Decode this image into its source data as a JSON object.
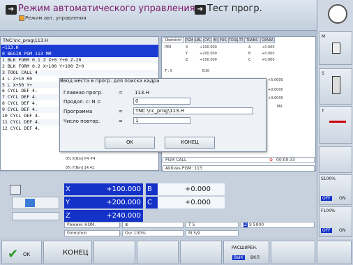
{
  "header": {
    "mode1_title": "Режим автоматического управления",
    "mode1_sub": "Режим авт. управления",
    "mode2_title": "Тест прогр."
  },
  "program": {
    "path": "TNC:\\nc_prog\\113.H",
    "current": "→113.H",
    "lines": [
      "0  BEGIN PGM 113 MM",
      "1  BLK FORM 0.1 Z X+0 Y+0 Z-20",
      "2  BLK FORM 0.2  X+100  Y+100  Z+0",
      "3  TOOL CALL 4",
      "4  L  Z+10 R0",
      "5  L  X+50  Y+",
      "6  CYCL DEF 4.",
      "7  CYCL DEF 4.",
      "8  CYCL DEF 4.",
      "9  CYCL DEF 4.",
      "10 CYCL DEF 4.",
      "11 CYCL DEF 4.",
      "12 CYCL DEF 4."
    ]
  },
  "status": {
    "tabs": [
      "Übersicht",
      "PGM",
      "LBL",
      "CYC",
      "M",
      "POS",
      "TOOL",
      "TT",
      "TRANS",
      "QPARA"
    ],
    "rows": [
      {
        "a": "PER",
        "b": "X",
        "c": "+100.000",
        "d": "A",
        "e": "+0.000"
      },
      {
        "a": "",
        "b": "Y",
        "c": "+200.000",
        "d": "B",
        "e": "+0.000"
      },
      {
        "a": "",
        "b": "Z",
        "c": "+100.000",
        "d": "C",
        "e": "+0.000"
      }
    ],
    "t_label": "T :  5",
    "t_name": "D10",
    "vals": [
      "+5.0000",
      "+0.0000",
      "+0.0000"
    ],
    "m": "M9",
    "pgm_call": "PGM CALL",
    "time": "00:00:33",
    "aktives": "Aktives PGM: 113",
    "bar1": "0% X[Nm] P4 -T4",
    "bar2": "0% Y[Nm] 14:41"
  },
  "dialog": {
    "title": "Ввод места в прогр. для поиска кадра",
    "main_label": "Главная прогр.",
    "main_eq": "=",
    "main_val": "113.H",
    "cont_label": "Продол. с:  N =",
    "cont_val": "0",
    "prog_label": "Программа",
    "prog_eq": "=",
    "prog_val": "TNC:\\nc_prog\\113.H",
    "rep_label": "Число повтор.",
    "rep_eq": "=",
    "rep_val": "1",
    "ok": "OK",
    "end": "КОНЕЦ"
  },
  "positions": {
    "axes": [
      {
        "l": "X",
        "v": "+100.000"
      },
      {
        "l": "Y",
        "v": "+200.000"
      },
      {
        "l": "Z",
        "v": "+240.000"
      }
    ],
    "axes2": [
      {
        "l": "B",
        "v": "+0.000"
      },
      {
        "l": "C",
        "v": "+0.000"
      }
    ],
    "mode": "Режим: НОМ.",
    "feed": "0mm/min",
    "ovr": "Ovr 100%",
    "t": "T 5",
    "s": "S 5000",
    "m": "M 5/9",
    "zlabel": "Z"
  },
  "right": {
    "m": "M",
    "s": "S",
    "t": "T",
    "s100": "S100%",
    "f100": "F100%",
    "off": "OFF",
    "on": "ON"
  },
  "softkeys": {
    "ok": "OK",
    "end": "КОНЕЦ",
    "ext": "РАСШИРЕН.",
    "off": "ВЫК",
    "on": "ВКЛ"
  }
}
